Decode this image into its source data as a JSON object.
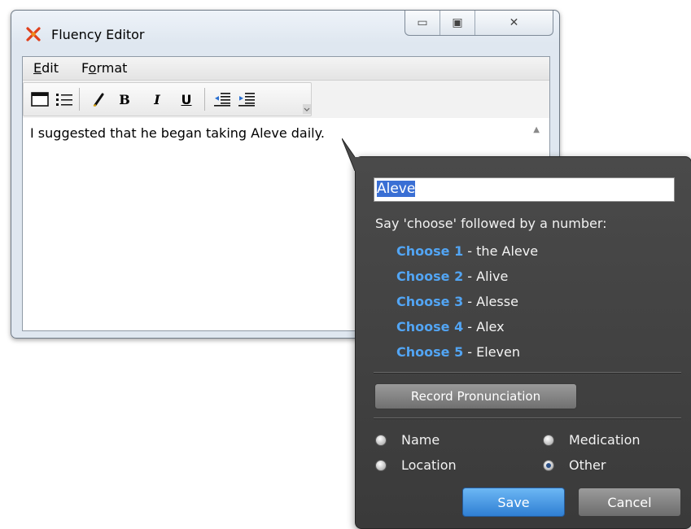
{
  "window": {
    "title": "Fluency Editor",
    "controls": {
      "minimize_glyph": "▭",
      "maximize_glyph": "▣",
      "close_glyph": "✕"
    }
  },
  "menu": {
    "edit": {
      "mnemonic": "E",
      "rest": "dit"
    },
    "format": {
      "pre": "F",
      "mnemonic": "o",
      "rest": "rmat"
    }
  },
  "toolbar": {
    "bold": "B",
    "italic": "I",
    "underline": "U"
  },
  "editor": {
    "text": "I suggested that he began taking Aleve daily."
  },
  "popup": {
    "word_value": "Aleve",
    "instruction": "Say 'choose' followed by a number:",
    "choices": [
      {
        "command": "Choose 1",
        "alternative": "- the Aleve"
      },
      {
        "command": "Choose 2",
        "alternative": "- Alive"
      },
      {
        "command": "Choose 3",
        "alternative": "- Alesse"
      },
      {
        "command": "Choose 4",
        "alternative": "- Alex"
      },
      {
        "command": "Choose 5",
        "alternative": "- Eleven"
      }
    ],
    "record_button": "Record Pronunciation",
    "categories": {
      "name": "Name",
      "medication": "Medication",
      "location": "Location",
      "other": "Other",
      "selected": "Other"
    },
    "save_button": "Save",
    "cancel_button": "Cancel"
  },
  "colors": {
    "choice_command": "#52a5f4",
    "popup_background": "#404040",
    "save_button": "#3f8fe0",
    "selection": "#3a6fd4"
  }
}
